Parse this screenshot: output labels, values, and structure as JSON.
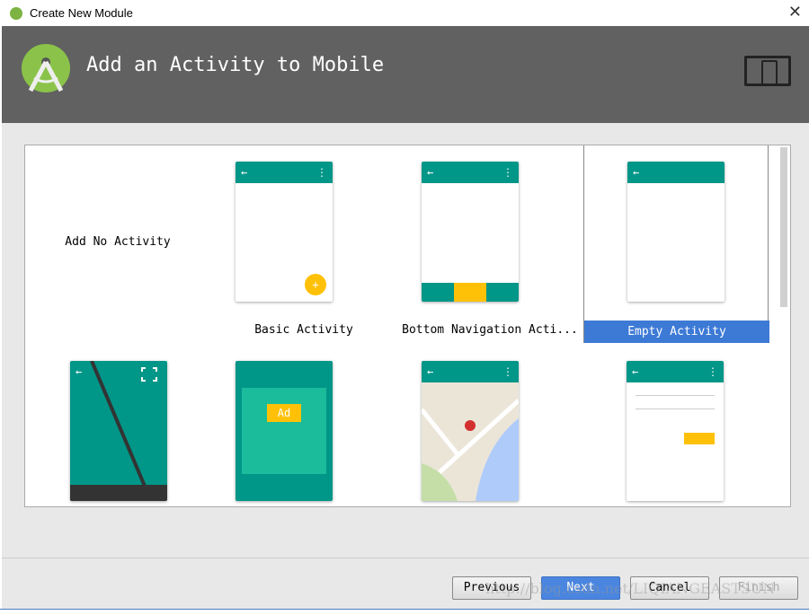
{
  "window": {
    "title": "Create New Module"
  },
  "header": {
    "title": "Add an Activity to Mobile"
  },
  "gallery": {
    "items": [
      {
        "label": "Add No Activity"
      },
      {
        "label": "Basic Activity"
      },
      {
        "label": "Bottom Navigation Acti..."
      },
      {
        "label": "Empty Activity",
        "selected": true
      },
      {
        "label": ""
      },
      {
        "label": ""
      },
      {
        "label": ""
      },
      {
        "label": ""
      }
    ],
    "ad_badge": "Ad"
  },
  "buttons": {
    "previous": "Previous",
    "next": "Next",
    "cancel": "Cancel",
    "finish": "Finish"
  },
  "watermark": "http://blog.csdn.net/LIQIANGEASTSUN",
  "colors": {
    "header": "#616161",
    "teal": "#009688",
    "selection": "#3d7ad6",
    "fab": "#ffc107"
  }
}
